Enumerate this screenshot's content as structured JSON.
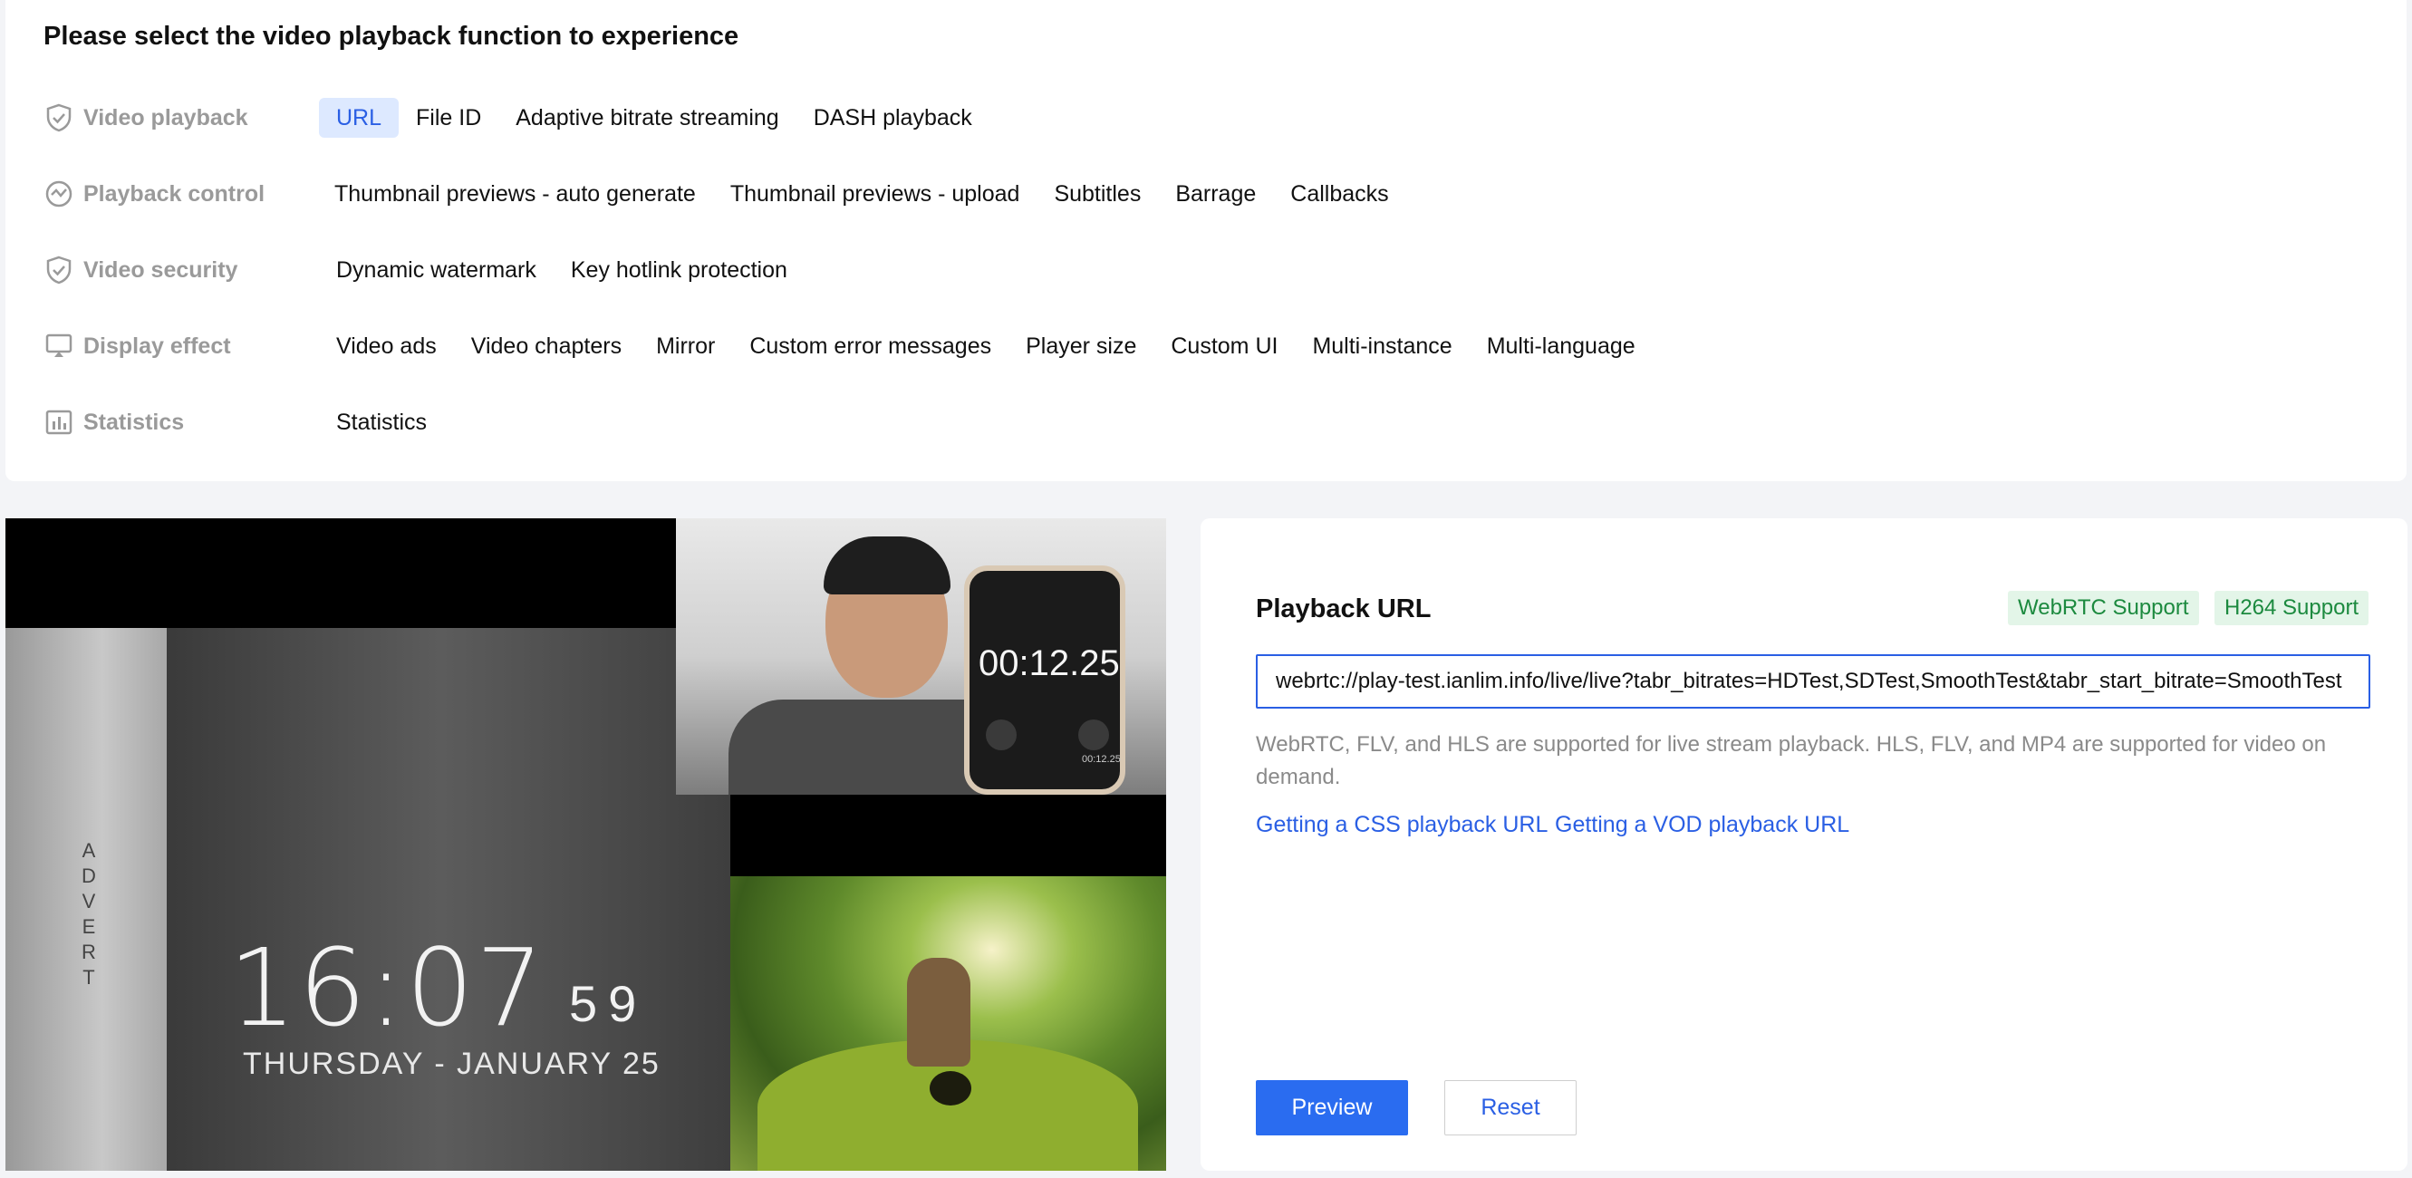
{
  "header": {
    "title": "Please select the video playback function to experience"
  },
  "categories": [
    {
      "label": "Video playback",
      "icon": "shield-check-icon",
      "options": [
        {
          "label": "URL",
          "active": true
        },
        {
          "label": "File ID"
        },
        {
          "label": "Adaptive bitrate streaming"
        },
        {
          "label": "DASH playback"
        }
      ]
    },
    {
      "label": "Playback control",
      "icon": "refresh-circle-icon",
      "options": [
        {
          "label": "Thumbnail previews - auto generate"
        },
        {
          "label": "Thumbnail previews - upload"
        },
        {
          "label": "Subtitles"
        },
        {
          "label": "Barrage"
        },
        {
          "label": "Callbacks"
        }
      ]
    },
    {
      "label": "Video security",
      "icon": "shield-check-icon",
      "options": [
        {
          "label": "Dynamic watermark"
        },
        {
          "label": "Key hotlink protection"
        }
      ]
    },
    {
      "label": "Display effect",
      "icon": "monitor-icon",
      "options": [
        {
          "label": "Video ads"
        },
        {
          "label": "Video chapters"
        },
        {
          "label": "Mirror"
        },
        {
          "label": "Custom error messages"
        },
        {
          "label": "Player size"
        },
        {
          "label": "Custom UI"
        },
        {
          "label": "Multi-instance"
        },
        {
          "label": "Multi-language"
        }
      ]
    },
    {
      "label": "Statistics",
      "icon": "bar-chart-icon",
      "options": [
        {
          "label": "Statistics"
        }
      ]
    }
  ],
  "video": {
    "advert": "ADVERT",
    "clock_time": "16:07",
    "clock_seconds": "59",
    "clock_date": "THURSDAY - JANUARY 25",
    "phone_timer": "00:12.25",
    "phone_small": "00:12.25"
  },
  "playback": {
    "title": "Playback URL",
    "tags": [
      "WebRTC Support",
      "H264 Support"
    ],
    "url_value": "webrtc://play-test.ianlim.info/live/live?tabr_bitrates=HDTest,SDTest,SmoothTest&tabr_start_bitrate=SmoothTest",
    "hint": "WebRTC, FLV, and HLS are supported for live stream playback. HLS, FLV, and MP4 are supported for video on demand.",
    "links": [
      "Getting a CSS playback URL",
      "Getting a VOD playback URL"
    ],
    "preview_label": "Preview",
    "reset_label": "Reset"
  },
  "colors": {
    "accent": "#2a5fe4",
    "tag_green": "#1c8a3f",
    "tag_bg": "#e3f5e8",
    "active_bg": "#dde9ff"
  }
}
